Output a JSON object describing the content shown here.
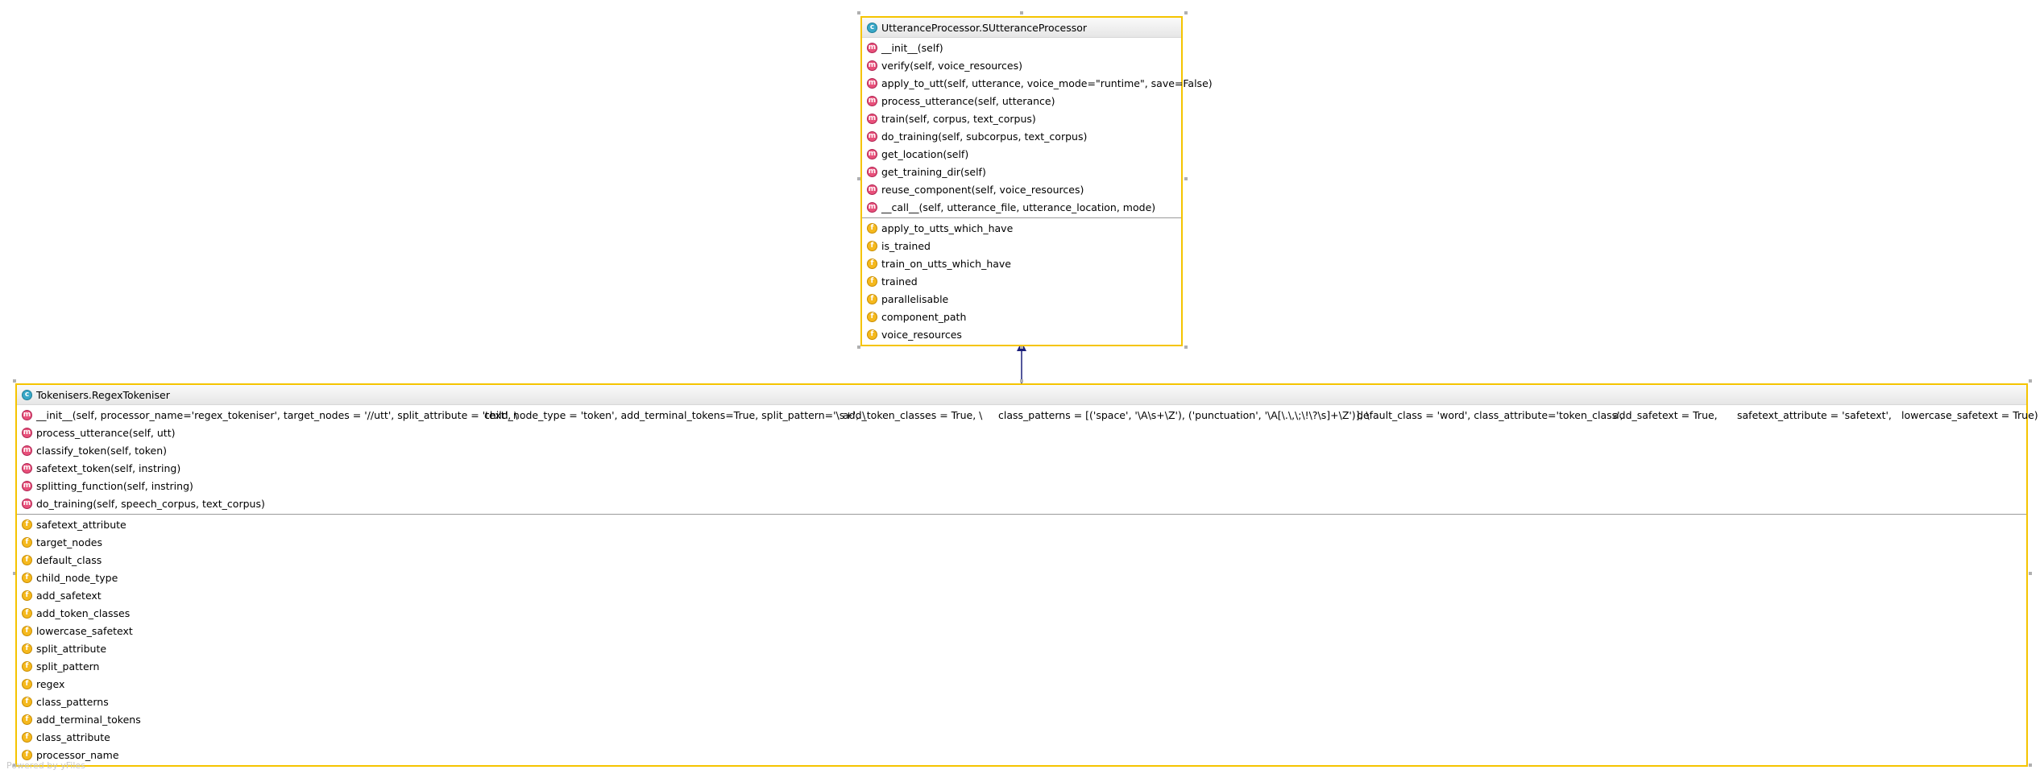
{
  "base_class": {
    "icon": "class-icon",
    "name": "UtteranceProcessor.SUtteranceProcessor",
    "methods": [
      "__init__(self)",
      "verify(self, voice_resources)",
      "apply_to_utt(self, utterance, voice_mode=\"runtime\", save=False)",
      "process_utterance(self, utterance)",
      "train(self, corpus, text_corpus)",
      "do_training(self, subcorpus, text_corpus)",
      "get_location(self)",
      "get_training_dir(self)",
      "reuse_component(self, voice_resources)",
      "__call__(self, utterance_file, utterance_location, mode)"
    ],
    "fields": [
      "apply_to_utts_which_have",
      "is_trained",
      "train_on_utts_which_have",
      "trained",
      "parallelisable",
      "component_path",
      "voice_resources"
    ]
  },
  "derived_class": {
    "icon": "class-icon",
    "name": "Tokenisers.RegexTokeniser",
    "init_signature_parts": [
      "__init__(self, processor_name='regex_tokeniser', target_nodes = '//utt', split_attribute = 'text', \\",
      "child_node_type = 'token', add_terminal_tokens=True, split_pattern='\\s+', \\",
      "add_token_classes = True, \\",
      "class_patterns = [('space', '\\A\\s+\\Z'), ('punctuation', '\\A[\\.\\,\\;\\!\\?\\s]+\\Z')], \\",
      "default_class = 'word', class_attribute='token_class',",
      "add_safetext = True,",
      "safetext_attribute = 'safetext',",
      "lowercase_safetext = True)"
    ],
    "methods": [
      "process_utterance(self, utt)",
      "classify_token(self, token)",
      "safetext_token(self, instring)",
      "splitting_function(self, instring)",
      "do_training(self, speech_corpus, text_corpus)"
    ],
    "fields": [
      "safetext_attribute",
      "target_nodes",
      "default_class",
      "child_node_type",
      "add_safetext",
      "add_token_classes",
      "lowercase_safetext",
      "split_attribute",
      "split_pattern",
      "regex",
      "class_patterns",
      "add_terminal_tokens",
      "class_attribute",
      "processor_name"
    ]
  },
  "member_icons": {
    "method": "method-icon",
    "field": "field-icon"
  },
  "icon_glyphs": {
    "class": "c",
    "method": "m",
    "field": "f"
  },
  "colors": {
    "class_border": "#f5c400",
    "arrow": "#1b1f7a",
    "method_icon": "#e8507a",
    "field_icon": "#f5b91e",
    "class_icon": "#39a8c8"
  },
  "footer": "Powered by yFiles"
}
